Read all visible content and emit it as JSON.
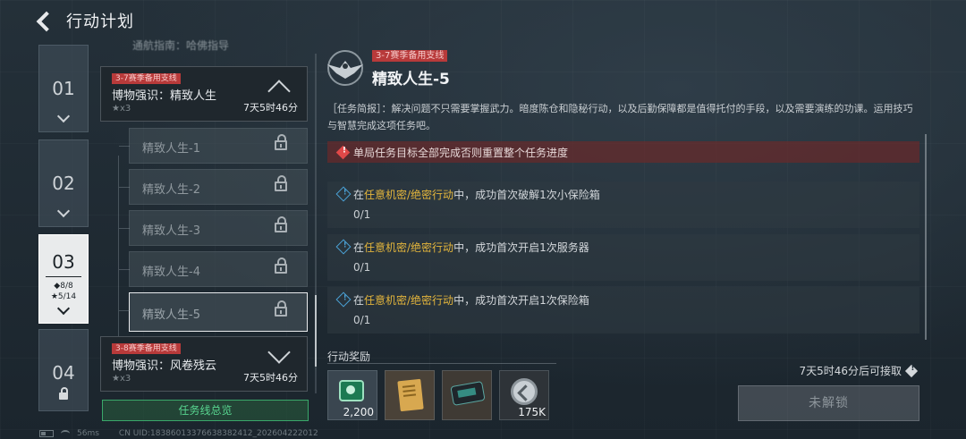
{
  "header": {
    "title": "行动计划"
  },
  "chapters": [
    {
      "num": "01"
    },
    {
      "num": "02"
    },
    {
      "num": "03",
      "diamonds": "◆8/8",
      "stars": "★5/14"
    },
    {
      "num": "04"
    }
  ],
  "list": {
    "faded_item": "通航指南：哈佛指导",
    "group_top": {
      "tag": "3-7赛季备用支线",
      "name": "博物强识：精致人生",
      "stars": "★x3",
      "time": "7天5时46分"
    },
    "sub_items": [
      "精致人生-1",
      "精致人生-2",
      "精致人生-3",
      "精致人生-4",
      "精致人生-5"
    ],
    "group_bottom": {
      "tag": "3-8赛季备用支线",
      "name": "博物强识：风卷残云",
      "stars": "★x3",
      "time": "7天5时46分"
    },
    "overview_button": "任务线总览"
  },
  "mission": {
    "tag": "3-7赛季备用支线",
    "title": "精致人生-5",
    "description": "［任务简报］：解决问题不只需要掌握武力。暗度陈仓和隐秘行动，以及后勤保障都是值得托付的手段，以及需要演练的功课。运用技巧与智慧完成这项任务吧。",
    "warning": "单局任务目标全部完成否则重置整个任务进度",
    "tasks": [
      {
        "pre": "在",
        "highlight": "任意机密/绝密行动",
        "post": "中，成功首次破解1次小保险箱",
        "progress": "0/1"
      },
      {
        "pre": "在",
        "highlight": "任意机密/绝密行动",
        "post": "中，成功首次开启1次服务器",
        "progress": "0/1"
      },
      {
        "pre": "在",
        "highlight": "任意机密/绝密行动",
        "post": "中，成功首次开启1次保险箱",
        "progress": "0/1"
      }
    ]
  },
  "rewards": {
    "label": "行动奖励",
    "items": [
      {
        "icon": "cash-icon",
        "count": "2,200"
      },
      {
        "icon": "document-icon",
        "count": ""
      },
      {
        "icon": "device-icon",
        "count": ""
      },
      {
        "icon": "coin-icon",
        "count": "175K"
      }
    ],
    "claim_info": "7天5时46分后可接取",
    "unlock_button": "未解锁"
  },
  "footer": {
    "ping": "56ms",
    "uid": "CN UID:18386013376638382412_202604222012"
  },
  "colors": {
    "accent_green": "#58d690",
    "tag_red": "#b83a3a",
    "highlight_gold": "#e3b53c",
    "info_blue": "#4ba3d8"
  }
}
